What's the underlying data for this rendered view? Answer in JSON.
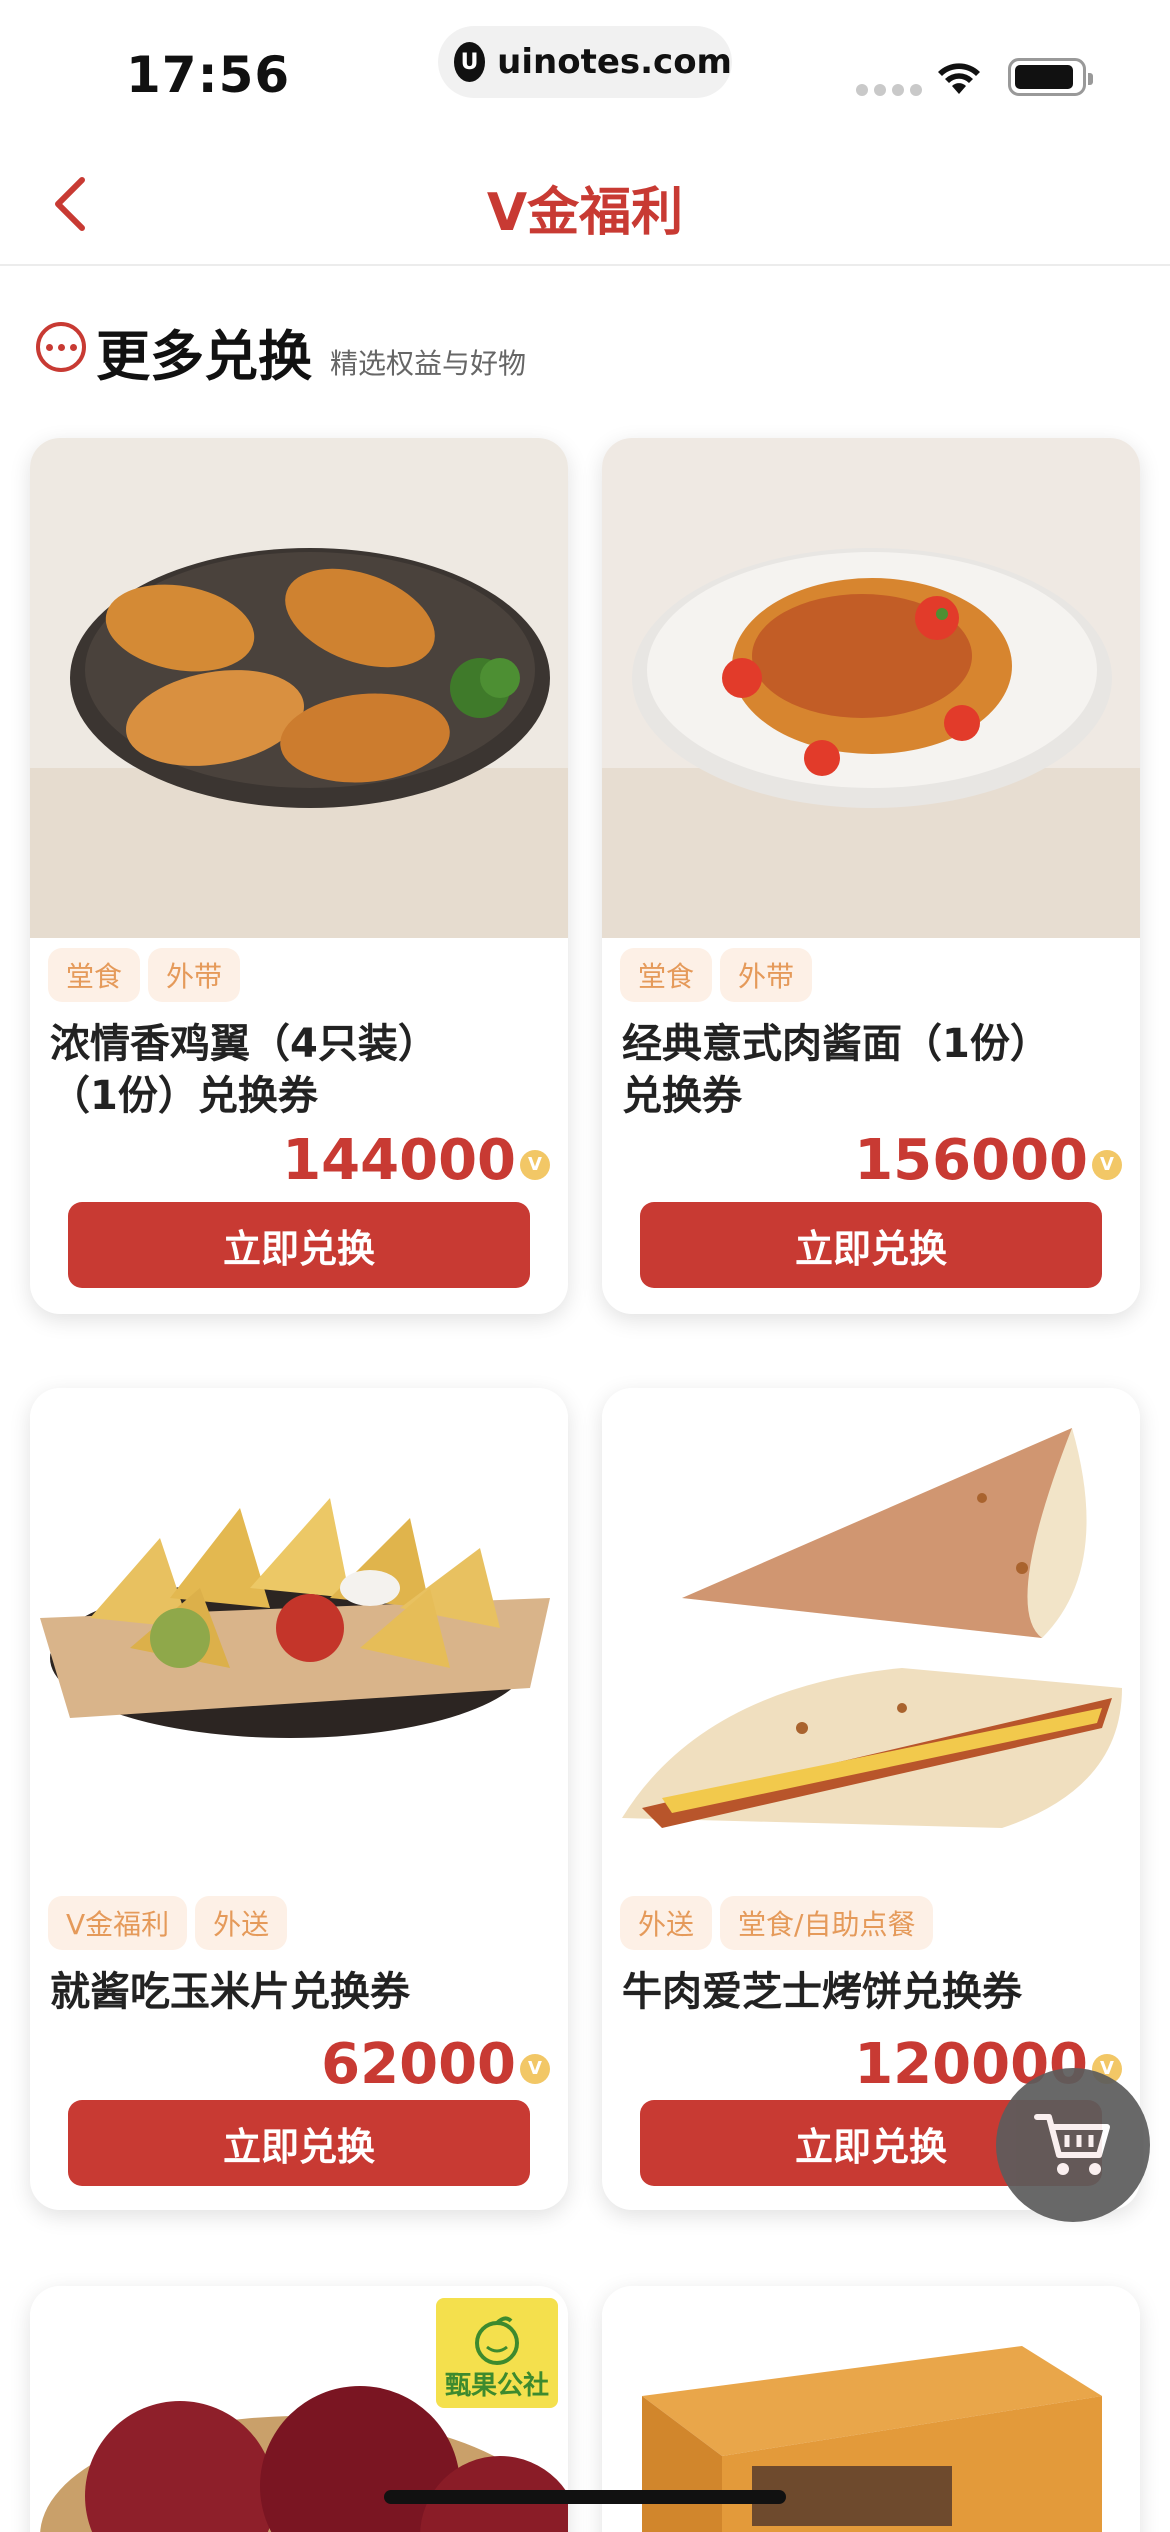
{
  "status_bar": {
    "time": "17:56",
    "url": "uinotes.com",
    "url_logo_letter": "U"
  },
  "nav": {
    "title": "V金福利",
    "back_icon": "chevron-left-icon"
  },
  "section": {
    "title": "更多兑换",
    "subtitle": "精选权益与好物",
    "icon": "more-dots-icon"
  },
  "currency_symbol": "V",
  "products": [
    {
      "tags": [
        "堂食",
        "外带"
      ],
      "name_line1": "浓情香鸡翼（4只装）",
      "name_line2": "（1份）兑换券",
      "price": "144000",
      "button": "立即兑换",
      "image": "chicken-wings-photo"
    },
    {
      "tags": [
        "堂食",
        "外带"
      ],
      "name_line1": "经典意式肉酱面（1份）",
      "name_line2": "兑换券",
      "price": "156000",
      "button": "立即兑换",
      "image": "spaghetti-photo"
    },
    {
      "tags": [
        "V金福利",
        "外送"
      ],
      "name_line1": "就酱吃玉米片兑换券",
      "name_line2": "",
      "price": "62000",
      "button": "立即兑换",
      "image": "nachos-photo"
    },
    {
      "tags": [
        "外送",
        "堂食/自助点餐"
      ],
      "name_line1": "牛肉爱芝士烤饼兑换券",
      "name_line2": "",
      "price": "120000",
      "button": "立即兑换",
      "image": "quesadilla-photo"
    }
  ],
  "partial_cards": [
    {
      "image": "apples-photo",
      "badge": "甄果公社"
    },
    {
      "image": "gift-box-photo"
    }
  ],
  "cart_fab": {
    "icon": "cart-icon"
  },
  "colors": {
    "accent": "#c83a33",
    "tag_bg": "#fdf0e6",
    "tag_text": "#e59a5a"
  }
}
